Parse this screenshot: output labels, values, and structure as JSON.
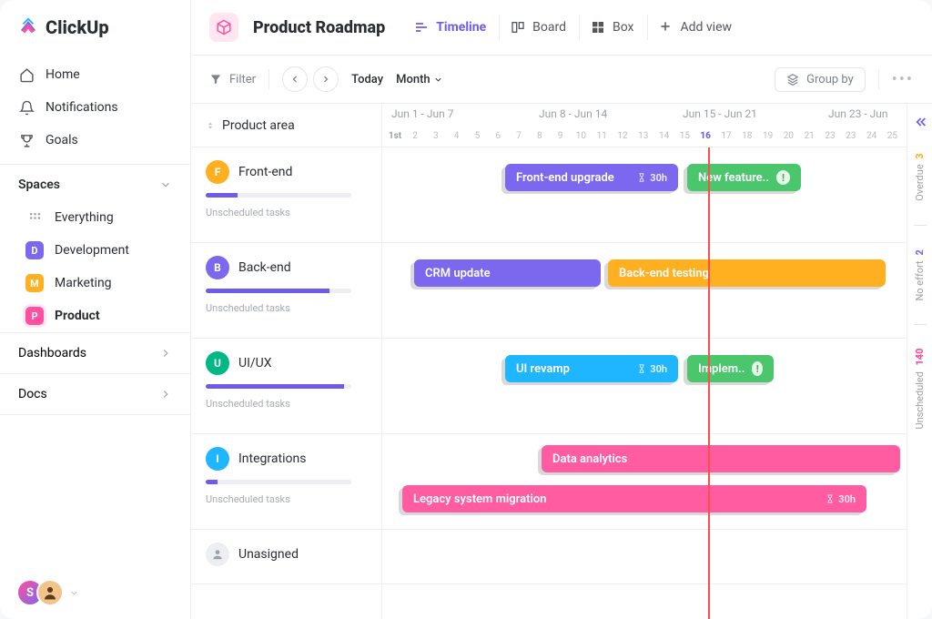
{
  "brand": {
    "name": "ClickUp"
  },
  "nav": {
    "home": "Home",
    "notifications": "Notifications",
    "goals": "Goals"
  },
  "spaces": {
    "header": "Spaces",
    "everything": "Everything",
    "items": [
      {
        "letter": "D",
        "label": "Development",
        "color": "#7b68ee"
      },
      {
        "letter": "M",
        "label": "Marketing",
        "color": "#ffb020"
      },
      {
        "letter": "P",
        "label": "Product",
        "color": "#ff4fa1",
        "active": true
      }
    ]
  },
  "sections": {
    "dashboards": "Dashboards",
    "docs": "Docs"
  },
  "header": {
    "title": "Product Roadmap",
    "views": {
      "timeline": "Timeline",
      "board": "Board",
      "box": "Box",
      "add": "Add view"
    }
  },
  "toolbar": {
    "filter": "Filter",
    "today": "Today",
    "range": "Month",
    "groupby": "Group by"
  },
  "timeline": {
    "left_header": "Product area",
    "weeks": [
      {
        "label": "Jun 1 - Jun 7"
      },
      {
        "label": "Jun 8 - Jun 14"
      },
      {
        "label": "Jun 15 - Jun 21"
      },
      {
        "label": "Jun 23 - Jun"
      }
    ],
    "first_marker": "1st",
    "days": [
      2,
      3,
      4,
      5,
      6,
      7,
      8,
      9,
      10,
      11,
      12,
      13,
      14,
      15,
      16,
      17,
      18,
      19,
      20,
      21,
      23,
      23,
      24,
      25
    ],
    "today_index": 16,
    "unscheduled_label": "Unscheduled tasks",
    "rows": [
      {
        "letter": "F",
        "label": "Front-end",
        "color": "#ffb020",
        "progress": 22
      },
      {
        "letter": "B",
        "label": "Back-end",
        "color": "#7b68ee",
        "progress": 85
      },
      {
        "letter": "U",
        "label": "UI/UX",
        "color": "#00b884",
        "progress": 95
      },
      {
        "letter": "I",
        "label": "Integrations",
        "color": "#1fb6ff",
        "progress": 8
      },
      {
        "letter": "",
        "label": "Unasigned",
        "color": "#d7dae0",
        "unassigned": true
      }
    ],
    "tasks": {
      "frontend_upgrade": {
        "label": "Front-end upgrade",
        "hours": "30h"
      },
      "new_feature": {
        "label": "New feature.."
      },
      "crm_update": {
        "label": "CRM update"
      },
      "backend_testing": {
        "label": "Back-end testing"
      },
      "ui_revamp": {
        "label": "UI revamp",
        "hours": "30h"
      },
      "implement": {
        "label": "Implem.."
      },
      "data_analytics": {
        "label": "Data analytics"
      },
      "legacy": {
        "label": "Legacy system migration",
        "hours": "30h"
      }
    }
  },
  "rail": {
    "overdue": {
      "count": "3",
      "label": "Overdue",
      "color": "#ffb020"
    },
    "noeffort": {
      "count": "2",
      "label": "No effort",
      "color": "#7b68ee"
    },
    "unscheduled": {
      "count": "140",
      "label": "Unscheduled",
      "color": "#ff4fa1"
    }
  },
  "colors": {
    "purple": "#7b68ee",
    "green": "#4cc66d",
    "orange": "#ffb020",
    "blue": "#1fb6ff",
    "pink": "#ff5ca2",
    "teal": "#00b884"
  }
}
